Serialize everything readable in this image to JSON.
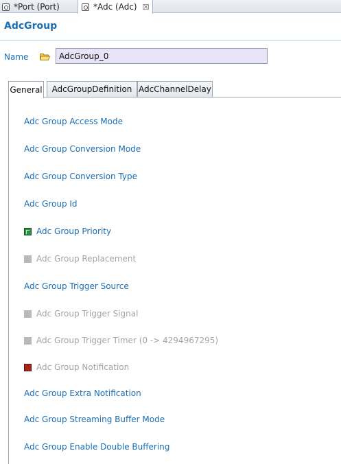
{
  "editor_tabs": [
    {
      "label": "*Port (Port)",
      "active": false,
      "closable": false
    },
    {
      "label": "*Adc (Adc)",
      "active": true,
      "closable": true,
      "close_glyph": "☒"
    }
  ],
  "header": {
    "title": "AdcGroup"
  },
  "name_field": {
    "label": "Name",
    "value": "AdcGroup_0",
    "icon": "folder-icon"
  },
  "tabs": [
    {
      "label": "General",
      "active": true
    },
    {
      "label": "AdcGroupDefinition",
      "active": false
    },
    {
      "label": "AdcChannelDelay",
      "active": false
    }
  ],
  "fields": [
    {
      "label": "Adc Group Access Mode",
      "enabled": true,
      "indicator": null
    },
    {
      "label": "Adc Group Conversion Mode",
      "enabled": true,
      "indicator": null
    },
    {
      "label": "Adc Group Conversion Type",
      "enabled": true,
      "indicator": null
    },
    {
      "label": "Adc Group Id",
      "enabled": true,
      "indicator": null
    },
    {
      "label": "Adc Group Priority",
      "enabled": true,
      "indicator": "green"
    },
    {
      "label": "Adc Group Replacement",
      "enabled": false,
      "indicator": "grey"
    },
    {
      "label": "Adc Group Trigger Source",
      "enabled": true,
      "indicator": null
    },
    {
      "label": "Adc Group Trigger Signal",
      "enabled": false,
      "indicator": "grey"
    },
    {
      "label": "Adc Group Trigger Timer (0 -> 4294967295)",
      "enabled": false,
      "indicator": "grey"
    },
    {
      "label": "Adc Group Notification",
      "enabled": false,
      "indicator": "red"
    },
    {
      "label": "Adc Group Extra Notification",
      "enabled": true,
      "indicator": null
    },
    {
      "label": "Adc Group Streaming Buffer Mode",
      "enabled": true,
      "indicator": null
    },
    {
      "label": "Adc Group Enable Double Buffering",
      "enabled": true,
      "indicator": null
    }
  ],
  "colors": {
    "link_blue": "#1a6eb3",
    "disabled_grey": "#a4a4a4",
    "input_bg": "#e8e3f7"
  }
}
